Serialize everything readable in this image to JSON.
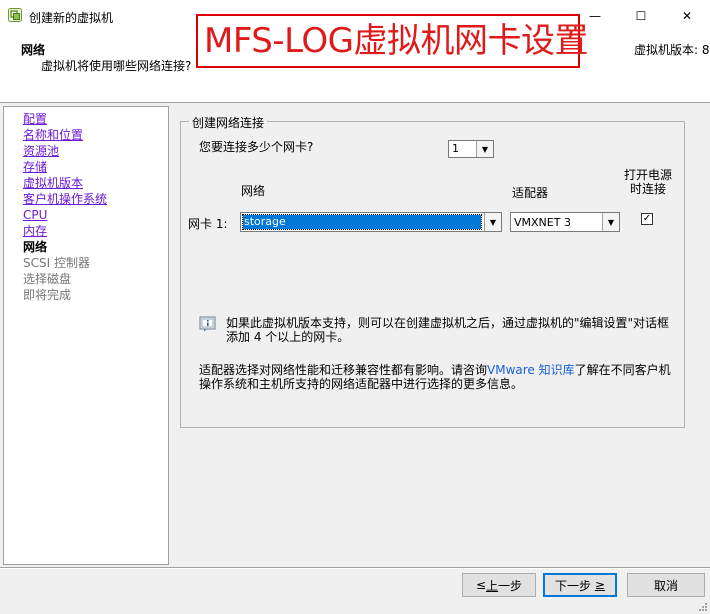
{
  "window": {
    "title": "创建新的虚拟机",
    "min_glyph": "—",
    "max_glyph": "☐",
    "close_glyph": "✕"
  },
  "header": {
    "title": "网络",
    "description": "虚拟机将使用哪些网络连接?",
    "version": "虚拟机版本: 8"
  },
  "banner": {
    "text": "MFS-LOG虚拟机网卡设置",
    "color": "#e01a1a"
  },
  "sidebar": {
    "items": [
      {
        "label": "配置",
        "state": "link"
      },
      {
        "label": "名称和位置",
        "state": "link"
      },
      {
        "label": "资源池",
        "state": "link"
      },
      {
        "label": "存储",
        "state": "link"
      },
      {
        "label": "虚拟机版本",
        "state": "link"
      },
      {
        "label": "客户机操作系统",
        "state": "link"
      },
      {
        "label": "CPU",
        "state": "link"
      },
      {
        "label": "内存",
        "state": "link"
      },
      {
        "label": "网络",
        "state": "current"
      },
      {
        "label": "SCSI 控制器",
        "state": "pending"
      },
      {
        "label": "选择磁盘",
        "state": "pending"
      },
      {
        "label": "即将完成",
        "state": "pending"
      }
    ]
  },
  "main": {
    "group_title": "创建网络连接",
    "nic_count_question": "您要连接多少个网卡?",
    "nic_count_value": "1",
    "col_network": "网络",
    "col_adapter": "适配器",
    "col_connect_line1": "打开电源",
    "col_connect_line2": "时连接",
    "nic_label": "网卡 1:",
    "network_value": "storage",
    "adapter_value": "VMXNET 3",
    "connect_checked": "✓",
    "info_text": "如果此虚拟机版本支持，则可以在创建虚拟机之后，通过虚拟机的\"编辑设置\"对话框添加 4 个以上的网卡。",
    "note_before": "适配器选择对网络性能和迁移兼容性都有影响。请咨询",
    "note_link": "VMware 知识库",
    "note_after": "了解在不同客户机操作系统和主机所支持的网络适配器中进行选择的更多信息。"
  },
  "footer": {
    "back_pre": "≤",
    "back_key": "上",
    "back_post": "一步",
    "next_pre": "下一步 ",
    "next_key": "≥",
    "cancel": "取消"
  },
  "colors": {
    "accent": "#0078d7",
    "link": "#6a1ad8",
    "kb_link": "#1a5fd8"
  }
}
